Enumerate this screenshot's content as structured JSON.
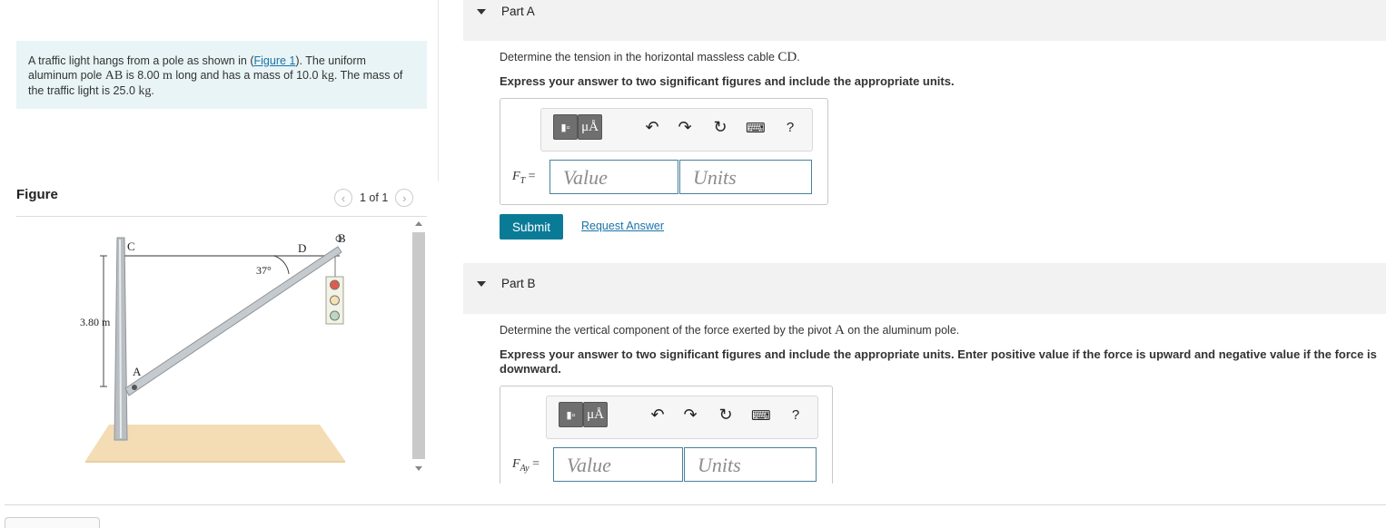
{
  "intro": {
    "p1": "A traffic light hangs from a pole as shown in (",
    "link": "Figure 1",
    "p2": "). The uniform aluminum pole ",
    "AB": "AB",
    "p3": " is 8.00 ",
    "m": "m",
    "p4": " long and has a mass of 10.0 ",
    "kg1": "kg",
    "p5": ". The mass of the traffic light is 25.0 ",
    "kg2": "kg",
    "p6": "."
  },
  "figure": {
    "title": "Figure",
    "pager": "1 of 1",
    "labels": {
      "C": "C",
      "D": "D",
      "B": "B",
      "A": "A",
      "angle": "37°",
      "height": "3.80 m"
    }
  },
  "partA": {
    "title": "Part A",
    "question_pre": "Determine the tension in the horizontal massless cable ",
    "question_sym": "CD",
    "question_post": ".",
    "instruction": "Express your answer to two significant figures and include the appropriate units.",
    "label_main": "F",
    "label_sub": "T",
    "label_eq": " =",
    "value_placeholder": "Value",
    "units_placeholder": "Units",
    "submit": "Submit",
    "request": "Request Answer"
  },
  "partB": {
    "title": "Part B",
    "question_pre": "Determine the vertical component of the force exerted by the pivot ",
    "question_sym": "A",
    "question_post": " on the aluminum pole.",
    "instruction": "Express your answer to two significant figures and include the appropriate units. Enter positive value if the force is upward and negative value if the force is downward.",
    "label_main": "F",
    "label_sub": "Ay",
    "label_eq": " =",
    "value_placeholder": "Value",
    "units_placeholder": "Units"
  },
  "toolbar": {
    "units_btn": "μÅ",
    "help": "?"
  },
  "icons": [
    "templates-icon",
    "units-icon",
    "undo-icon",
    "redo-icon",
    "reset-icon",
    "keyboard-icon",
    "help-icon",
    "chevron-left-icon",
    "chevron-right-icon",
    "collapse-triangle-icon"
  ]
}
